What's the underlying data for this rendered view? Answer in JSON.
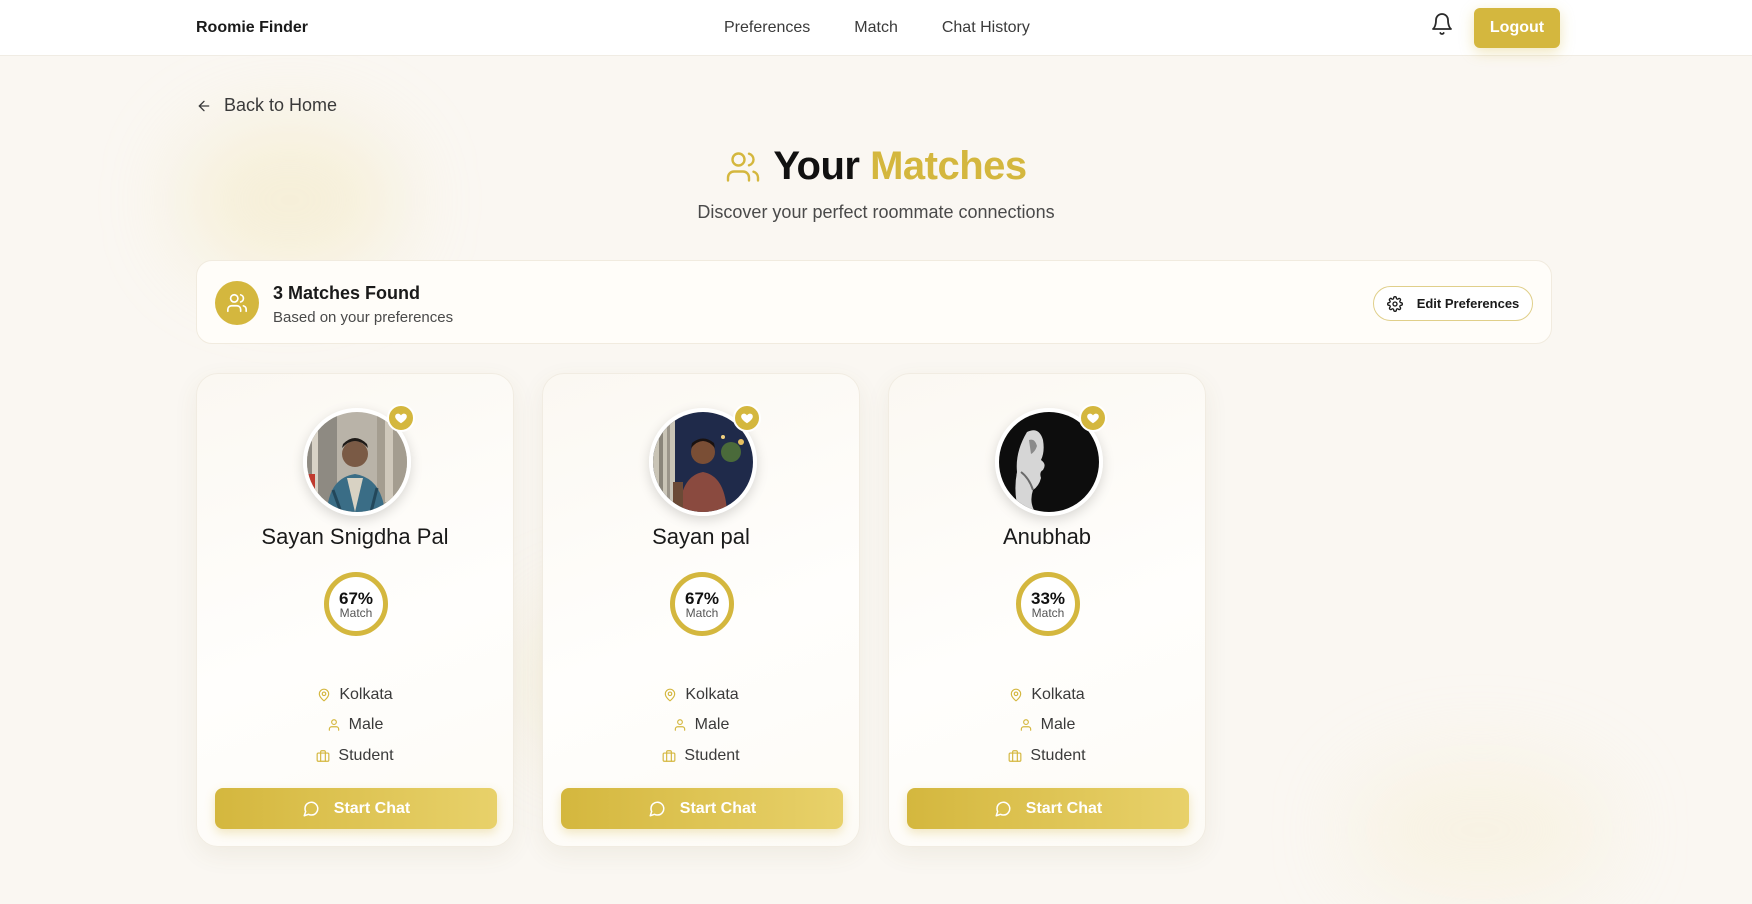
{
  "nav": {
    "brand": "Roomie Finder",
    "links": [
      "Preferences",
      "Match",
      "Chat History"
    ],
    "logout_label": "Logout",
    "bell_icon": "bell-icon"
  },
  "back_label": "Back to Home",
  "header": {
    "title_part1": "Your",
    "title_part2": "Matches",
    "subtitle": "Discover your perfect roommate connections"
  },
  "summary": {
    "title": "3 Matches Found",
    "subtitle": "Based on your preferences",
    "edit_label": "Edit Preferences"
  },
  "matches": [
    {
      "name": "Sayan Snigdha Pal",
      "percent": "67%",
      "match_label": "Match",
      "location": "Kolkata",
      "gender": "Male",
      "occupation": "Student",
      "chat_label": "Start Chat"
    },
    {
      "name": "Sayan pal",
      "percent": "67%",
      "match_label": "Match",
      "location": "Kolkata",
      "gender": "Male",
      "occupation": "Student",
      "chat_label": "Start Chat"
    },
    {
      "name": "Anubhab",
      "percent": "33%",
      "match_label": "Match",
      "location": "Kolkata",
      "gender": "Male",
      "occupation": "Student",
      "chat_label": "Start Chat"
    }
  ],
  "colors": {
    "accent": "#d4b73e",
    "background": "#faf7f2"
  }
}
